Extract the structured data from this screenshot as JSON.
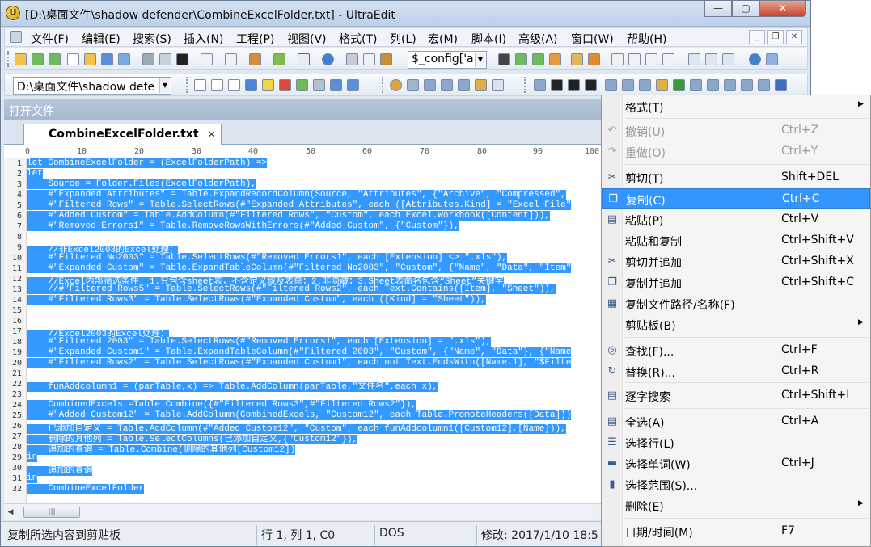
{
  "window": {
    "title": "[D:\\桌面文件\\shadow defender\\CombineExcelFolder.txt] - UltraEdit",
    "buttons": {
      "minimize": "—",
      "maximize": "▢",
      "close": "✕"
    }
  },
  "menubar": {
    "items": [
      "文件(F)",
      "编辑(E)",
      "搜索(S)",
      "插入(N)",
      "工程(P)",
      "视图(V)",
      "格式(T)",
      "列(L)",
      "宏(M)",
      "脚本(I)",
      "高级(A)",
      "窗口(W)",
      "帮助(H)"
    ],
    "mdi": {
      "minimize": "_",
      "restore": "❐",
      "close": "✕"
    }
  },
  "toolbar": {
    "search_combo_value": "$_config['a",
    "path_combo_value": "D:\\桌面文件\\shadow defe"
  },
  "panel": {
    "header": "打开文件"
  },
  "tab": {
    "label": "CombineExcelFolder.txt",
    "close": "×"
  },
  "ruler": [
    "0",
    "10",
    "20",
    "30",
    "40",
    "50",
    "60",
    "70",
    "80",
    "90",
    "100"
  ],
  "editor": {
    "line_numbers": [
      "1",
      "2",
      "3",
      "4",
      "5",
      "6",
      "7",
      "8",
      "9",
      "10",
      "11",
      "12",
      "13",
      "14",
      "15",
      "16",
      "17",
      "18",
      "19",
      "20",
      "21",
      "22",
      "23",
      "24",
      "25",
      "26",
      "27",
      "28",
      "29",
      "30",
      "31",
      "32"
    ],
    "lines": [
      "let CombineExcelFolder = (ExcelFolderPath) =>",
      "let",
      "    Source = Folder.Files(ExcelFolderPath),",
      "    #\"Expanded Attributes\" = Table.ExpandRecordColumn(Source, \"Attributes\", {\"Archive\", \"Compressed\",",
      "    #\"Filtered Rows\" = Table.SelectRows(#\"Expanded Attributes\", each ([Attributes.Kind] = \"Excel File\"",
      "    #\"Added Custom\" = Table.AddColumn(#\"Filtered Rows\", \"Custom\", each Excel.Workbook([Content])),",
      "    #\"Removed Errors1\" = Table.RemoveRowsWithErrors(#\"Added Custom\", {\"Custom\"}),",
      "",
      "    //非Excel2003的Excel处理：",
      "    #\"Filtered No2003\" = Table.SelectRows(#\"Removed Errors1\", each [Extension] <> \".xls\"),",
      "    #\"Expanded Custom\" = Table.ExpandTableColumn(#\"Filtered No2003\", \"Custom\", {\"Name\", \"Data\", \"Item\"",
      "    //Excel内部筛选条件  1.只包含sheet表，不含定义域及表单；2.非隐藏；3.Sheet表命名包含“Sheet”关键字",
      "    //#\"Filtered Rows5\" = Table.SelectRows(#\"Filtered Rows2\", each Text.Contains([Item], \"Sheet\")),",
      "    #\"Filtered Rows3\" = Table.SelectRows(#\"Expanded Custom\", each ([Kind] = \"Sheet\")),",
      "",
      "",
      "    //Excel2003的Excel处理：",
      "    #\"Filtered 2003\" = Table.SelectRows(#\"Removed Errors1\", each [Extension] = \".xls\"),",
      "    #\"Expanded Custom1\" = Table.ExpandTableColumn(#\"Filtered 2003\", \"Custom\", {\"Name\", \"Data\"}, {\"Name",
      "    #\"Filtered Rows2\" = Table.SelectRows(#\"Expanded Custom1\", each not Text.EndsWith([Name.1], \"$Filte",
      "",
      "    funAddcolumn1 = (parTable,x) => Table.AddColumn(parTable,\"文件名\",each x),",
      "",
      "    CombinedExcels =Table.Combine({#\"Filtered Rows3\",#\"Filtered Rows2\"}),",
      "    #\"Added Custom12\" = Table.AddColumn(CombinedExcels, \"Custom12\", each Table.PromoteHeaders([Data]))",
      "    已添加自定义 = Table.AddColumn(#\"Added Custom12\", \"Custom\", each funAddcolumn1([Custom12],[Name])),",
      "    删除的其他列 = Table.SelectColumns(已添加自定义,{\"Custom12\"}),",
      "    追加的查询 = Table.Combine(删除的其他列[Custom12])",
      "in",
      "    追加的查询",
      "in",
      "    CombineExcelFolder"
    ]
  },
  "statusbar": {
    "message": "复制所选内容到剪贴板",
    "position": "行 1, 列 1, C0",
    "line_ending": "DOS",
    "modified": "修改: 2017/1/10 18:5"
  },
  "context_menu": {
    "items": [
      {
        "label": "格式(T)",
        "shortcut": "",
        "submenu": true,
        "icon": "none",
        "disabled": false
      },
      {
        "label": "撤销(U)",
        "shortcut": "Ctrl+Z",
        "submenu": false,
        "icon": "undo-icon",
        "disabled": true
      },
      {
        "label": "重做(O)",
        "shortcut": "Ctrl+Y",
        "submenu": false,
        "icon": "redo-icon",
        "disabled": true
      },
      {
        "label": "剪切(T)",
        "shortcut": "Shift+DEL",
        "submenu": false,
        "icon": "cut-icon",
        "disabled": false
      },
      {
        "label": "复制(C)",
        "shortcut": "Ctrl+C",
        "submenu": false,
        "icon": "copy-icon",
        "disabled": false,
        "highlighted": true
      },
      {
        "label": "粘贴(P)",
        "shortcut": "Ctrl+V",
        "submenu": false,
        "icon": "paste-icon",
        "disabled": false
      },
      {
        "label": "粘贴和复制",
        "shortcut": "Ctrl+Shift+V",
        "submenu": false,
        "icon": "none",
        "disabled": false
      },
      {
        "label": "剪切并追加",
        "shortcut": "Ctrl+Shift+X",
        "submenu": false,
        "icon": "cut-append-icon",
        "disabled": false
      },
      {
        "label": "复制并追加",
        "shortcut": "Ctrl+Shift+C",
        "submenu": false,
        "icon": "copy-append-icon",
        "disabled": false
      },
      {
        "label": "复制文件路径/名称(F)",
        "shortcut": "",
        "submenu": false,
        "icon": "copy-path-icon",
        "disabled": false
      },
      {
        "label": "剪贴板(B)",
        "shortcut": "",
        "submenu": true,
        "icon": "none",
        "disabled": false
      },
      {
        "label": "查找(F)...",
        "shortcut": "Ctrl+F",
        "submenu": false,
        "icon": "binoculars-icon",
        "disabled": false
      },
      {
        "label": "替换(R)...",
        "shortcut": "Ctrl+R",
        "submenu": false,
        "icon": "replace-icon",
        "disabled": false
      },
      {
        "label": "逐字搜索",
        "shortcut": "Ctrl+Shift+I",
        "submenu": false,
        "icon": "incremental-search-icon",
        "disabled": false
      },
      {
        "label": "全选(A)",
        "shortcut": "Ctrl+A",
        "submenu": false,
        "icon": "select-all-icon",
        "disabled": false
      },
      {
        "label": "选择行(L)",
        "shortcut": "",
        "submenu": false,
        "icon": "select-line-icon",
        "disabled": false
      },
      {
        "label": "选择单词(W)",
        "shortcut": "Ctrl+J",
        "submenu": false,
        "icon": "select-word-icon",
        "disabled": false
      },
      {
        "label": "选择范围(S)...",
        "shortcut": "",
        "submenu": false,
        "icon": "select-range-icon",
        "disabled": false
      },
      {
        "label": "删除(E)",
        "shortcut": "",
        "submenu": true,
        "icon": "none",
        "disabled": false
      },
      {
        "label": "日期/时间(M)",
        "shortcut": "F7",
        "submenu": false,
        "icon": "none",
        "disabled": false
      }
    ]
  },
  "colors": {
    "selection": "#3399ff",
    "menu_highlight": "#3296fe",
    "titlebar": "#c6d8ee"
  }
}
